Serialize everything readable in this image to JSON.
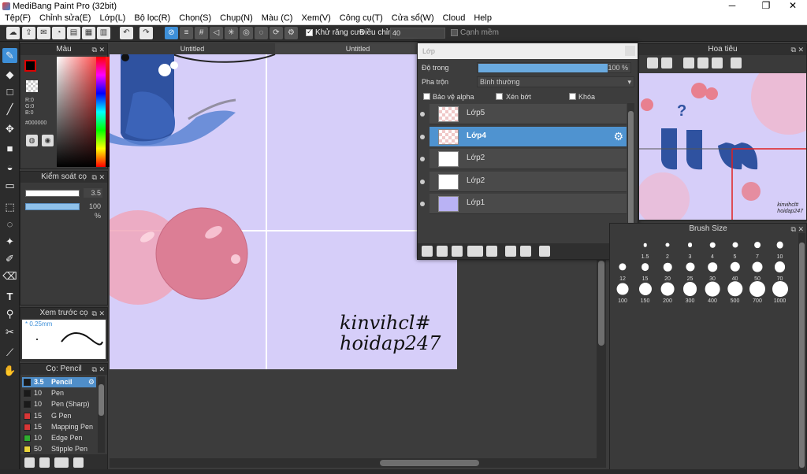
{
  "window": {
    "title": "MediBang Paint Pro (32bit)",
    "minimize": "─",
    "maximize": "❐",
    "close": "✕"
  },
  "menu": [
    "Tệp(F)",
    "Chỉnh sửa(E)",
    "Lớp(L)",
    "Bộ lọc(R)",
    "Chọn(S)",
    "Chụp(N)",
    "Màu (C)",
    "Xem(V)",
    "Công cụ(T)",
    "Cửa sổ(W)",
    "Cloud",
    "Help"
  ],
  "toolbar": {
    "antialias_label": "Khử răng cưa",
    "antialias_checked": true,
    "correction_label": "Điều chỉnh",
    "correction_value": "40",
    "edge_label": "Cạnh mềm",
    "edge_checked": false
  },
  "color_panel": {
    "title": "Màu",
    "r": "R:0",
    "g": "G:0",
    "b": "B:0",
    "hex": "#000000",
    "fg_color": "#000000",
    "bg_color": "#ffffff"
  },
  "brush_control": {
    "title": "Kiểm soát cọ",
    "size_value": "3.5",
    "opacity_value": "100 %"
  },
  "brush_preview": {
    "title": "Xem trước cọ",
    "size_text": "* 0.25mm"
  },
  "brush_list": {
    "title": "Cọ: Pencil",
    "items": [
      {
        "size": "3.5",
        "name": "Pencil",
        "color": "#1a1a1a",
        "selected": true
      },
      {
        "size": "10",
        "name": "Pen",
        "color": "#1a1a1a",
        "selected": false
      },
      {
        "size": "10",
        "name": "Pen (Sharp)",
        "color": "#1a1a1a",
        "selected": false
      },
      {
        "size": "15",
        "name": "G Pen",
        "color": "#d93636",
        "selected": false
      },
      {
        "size": "15",
        "name": "Mapping Pen",
        "color": "#d93636",
        "selected": false
      },
      {
        "size": "10",
        "name": "Edge Pen",
        "color": "#2fae2f",
        "selected": false
      },
      {
        "size": "50",
        "name": "Stipple Pen",
        "color": "#e8d43a",
        "selected": false
      }
    ]
  },
  "canvas": {
    "tabs": [
      "Untitled",
      "Untitled"
    ],
    "watermark_line1": "kinvihcl#",
    "watermark_line2": "hoidap247"
  },
  "layer_window": {
    "title": "Lớp",
    "opacity_label": "Độ trong",
    "opacity_value": "100 %",
    "opacity_percent": 100,
    "blend_label": "Pha trộn",
    "blend_value": "Bình thường",
    "protect_alpha": "Bảo vệ alpha",
    "clipping": "Xén bớt",
    "lock": "Khóa",
    "layers": [
      {
        "name": "Lớp5",
        "thumb": "checker",
        "selected": false
      },
      {
        "name": "Lớp4",
        "thumb": "checker",
        "selected": true
      },
      {
        "name": "Lớp2",
        "thumb": "text",
        "selected": false
      },
      {
        "name": "Lớp2",
        "thumb": "text",
        "selected": false
      },
      {
        "name": "Lớp1",
        "thumb": "purple",
        "selected": false
      }
    ]
  },
  "navigator": {
    "title": "Hoa tiêu",
    "sign1": "kinvihcl#",
    "sign2": "hoidap247"
  },
  "brush_size": {
    "title": "Brush Size",
    "sizes": [
      "1.5",
      "2",
      "3",
      "4",
      "5",
      "7",
      "10",
      "12",
      "15",
      "20",
      "25",
      "30",
      "40",
      "50",
      "70",
      "100",
      "150",
      "200",
      "300",
      "400",
      "500",
      "700",
      "1000"
    ]
  },
  "colors": {
    "accent": "#3d8fd8",
    "canvas_bg": "#d6cef9",
    "panel_bg": "#3a3a3a"
  }
}
